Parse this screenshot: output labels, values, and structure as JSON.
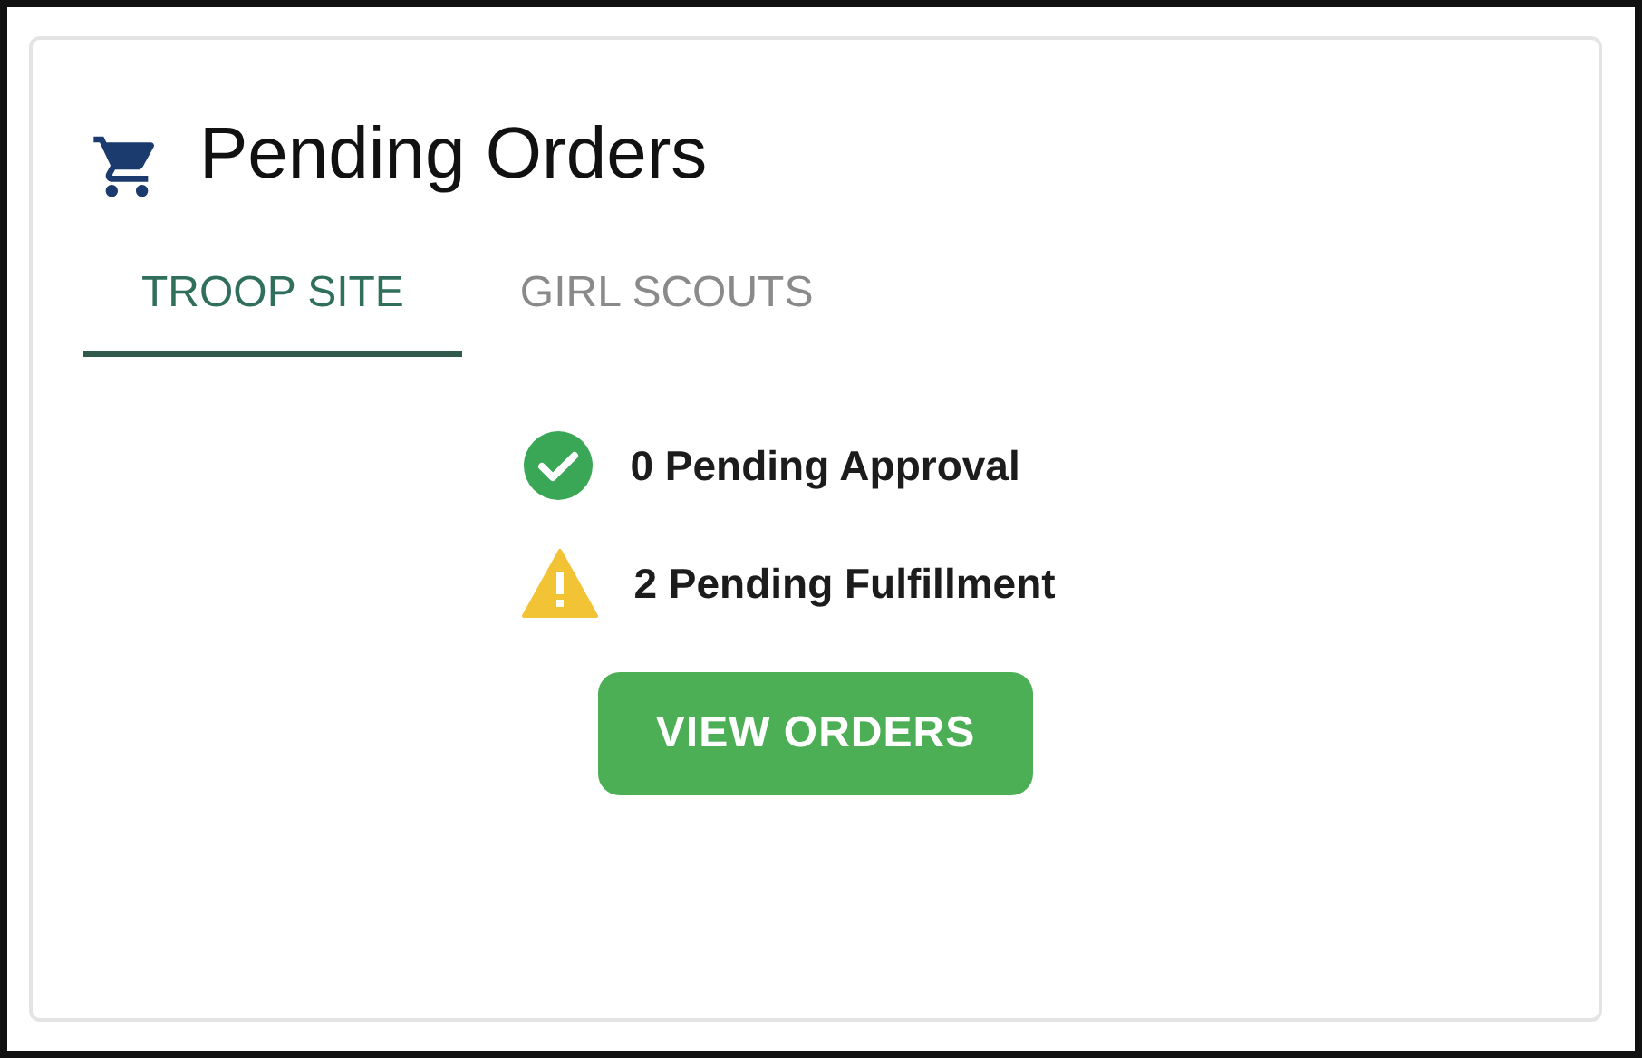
{
  "card": {
    "title": "Pending Orders"
  },
  "tabs": [
    {
      "label": "TROOP SITE",
      "selected": true
    },
    {
      "label": "GIRL SCOUTS",
      "selected": false
    }
  ],
  "statuses": [
    {
      "kind": "success",
      "text": "0 Pending Approval"
    },
    {
      "kind": "warning",
      "text": "2 Pending Fulfillment"
    }
  ],
  "button": {
    "label": "VIEW ORDERS"
  }
}
